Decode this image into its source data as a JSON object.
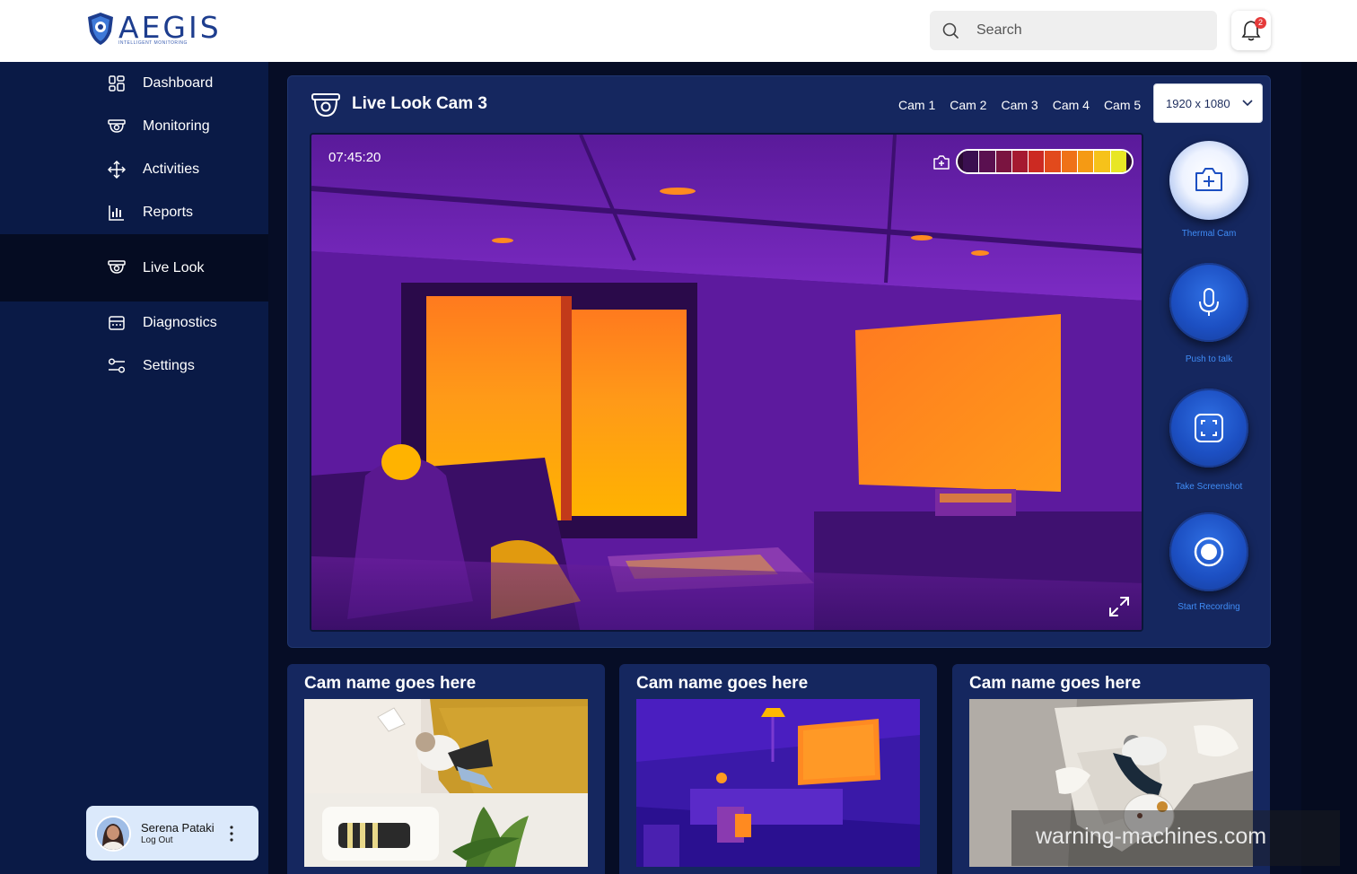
{
  "brand": {
    "name": "AEGIS",
    "tagline": "INTELLIGENT MONITORING"
  },
  "search": {
    "placeholder": "Search"
  },
  "notifications": {
    "count": "2"
  },
  "sidebar": {
    "items": [
      {
        "label": "Dashboard",
        "icon": "dashboard-icon"
      },
      {
        "label": "Monitoring",
        "icon": "camera-icon"
      },
      {
        "label": "Activities",
        "icon": "move-icon"
      },
      {
        "label": "Reports",
        "icon": "bar-chart-icon"
      },
      {
        "label": "Live Look",
        "icon": "camera-icon",
        "active": true
      },
      {
        "label": "Diagnostics",
        "icon": "diagnostics-icon"
      },
      {
        "label": "Settings",
        "icon": "sliders-icon"
      }
    ]
  },
  "user": {
    "name": "Serena Pataki",
    "action": "Log Out"
  },
  "live": {
    "title": "Live Look Cam 3",
    "cam_tabs": [
      "Cam 1",
      "Cam 2",
      "Cam 3",
      "Cam 4",
      "Cam 5"
    ],
    "resolution": "1920 x 1080",
    "timestamp": "07:45:20",
    "controls": [
      {
        "label": "Thermal Cam",
        "icon": "camera-plus-icon"
      },
      {
        "label": "Push to talk",
        "icon": "microphone-icon"
      },
      {
        "label": "Take Screenshot",
        "icon": "screenshot-icon"
      },
      {
        "label": "Start Recording",
        "icon": "record-icon"
      }
    ]
  },
  "cards": [
    {
      "title": "Cam name goes here"
    },
    {
      "title": "Cam name goes here"
    },
    {
      "title": "Cam name goes here"
    }
  ],
  "watermark": "warning-machines.com",
  "colors": {
    "sidebar": "#0a1a46",
    "panel": "#15275f",
    "accent": "#1c4fc2",
    "label_blue": "#3f8cf6"
  }
}
